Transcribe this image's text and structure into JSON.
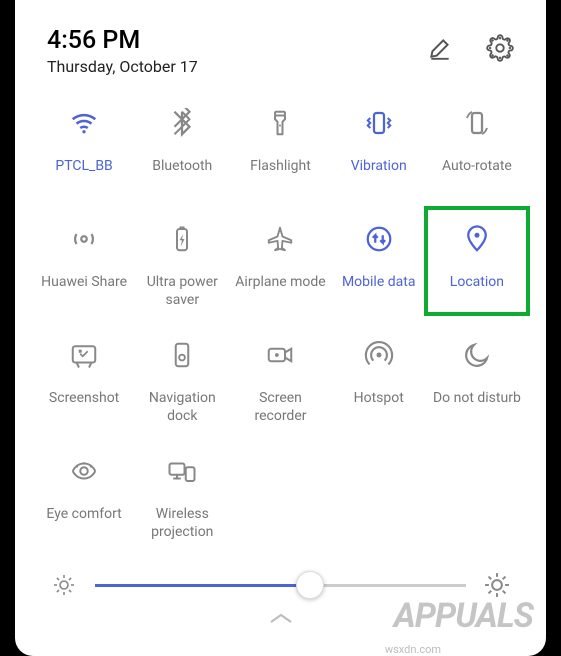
{
  "header": {
    "time": "4:56 PM",
    "date": "Thursday, October 17"
  },
  "tiles": [
    {
      "key": "wifi",
      "label": "PTCL_BB",
      "icon": "wifi-icon",
      "active": true,
      "highlight": false
    },
    {
      "key": "bluetooth",
      "label": "Bluetooth",
      "icon": "bluetooth-icon",
      "active": false,
      "highlight": false
    },
    {
      "key": "flashlight",
      "label": "Flashlight",
      "icon": "flashlight-icon",
      "active": false,
      "highlight": false
    },
    {
      "key": "vibration",
      "label": "Vibration",
      "icon": "vibration-icon",
      "active": true,
      "highlight": false
    },
    {
      "key": "autorotate",
      "label": "Auto-rotate",
      "icon": "autorotate-icon",
      "active": false,
      "highlight": false
    },
    {
      "key": "huaweishare",
      "label": "Huawei Share",
      "icon": "huaweishare-icon",
      "active": false,
      "highlight": false
    },
    {
      "key": "ultrapower",
      "label": "Ultra power\nsaver",
      "icon": "battery-icon",
      "active": false,
      "highlight": false
    },
    {
      "key": "airplane",
      "label": "Airplane mode",
      "icon": "airplane-icon",
      "active": false,
      "highlight": false
    },
    {
      "key": "mobiledata",
      "label": "Mobile data",
      "icon": "mobiledata-icon",
      "active": true,
      "highlight": false
    },
    {
      "key": "location",
      "label": "Location",
      "icon": "location-icon",
      "active": true,
      "highlight": true
    },
    {
      "key": "screenshot",
      "label": "Screenshot",
      "icon": "screenshot-icon",
      "active": false,
      "highlight": false
    },
    {
      "key": "navdock",
      "label": "Navigation\ndock",
      "icon": "navdock-icon",
      "active": false,
      "highlight": false
    },
    {
      "key": "screenrec",
      "label": "Screen\nrecorder",
      "icon": "screenrec-icon",
      "active": false,
      "highlight": false
    },
    {
      "key": "hotspot",
      "label": "Hotspot",
      "icon": "hotspot-icon",
      "active": false,
      "highlight": false
    },
    {
      "key": "dnd",
      "label": "Do not disturb",
      "icon": "moon-icon",
      "active": false,
      "highlight": false
    },
    {
      "key": "eyecomfort",
      "label": "Eye comfort",
      "icon": "eye-icon",
      "active": false,
      "highlight": false
    },
    {
      "key": "wireless",
      "label": "Wireless\nprojection",
      "icon": "wireless-icon",
      "active": false,
      "highlight": false
    }
  ],
  "brightness": {
    "value_pct": 58
  },
  "watermark": {
    "brand": "APPUALS",
    "credit": "wsxdn.com"
  },
  "colors": {
    "accent": "#4d63d6",
    "icon_inactive": "#888",
    "highlight_border": "#0dab2f"
  }
}
